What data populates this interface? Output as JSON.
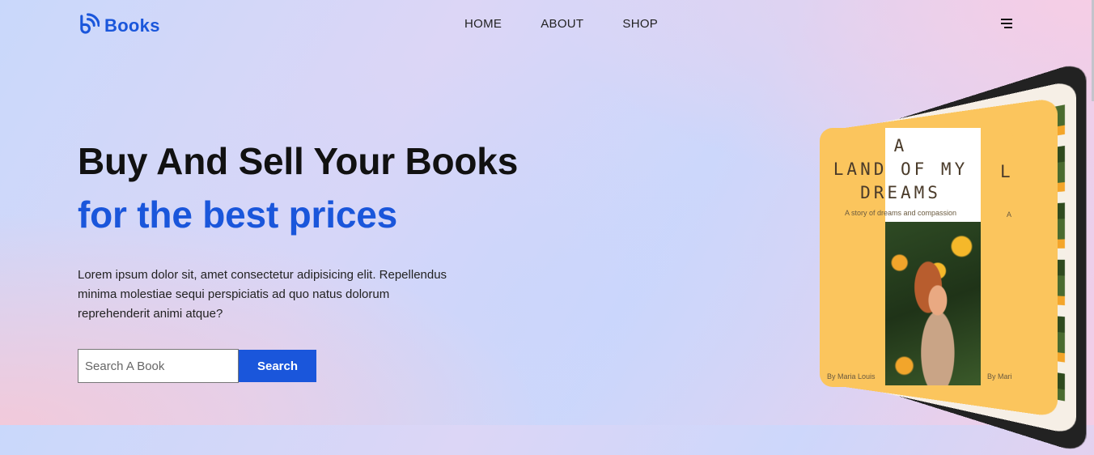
{
  "brand": {
    "name": "Books",
    "accent": "#1a56db",
    "icon": "rss-book-icon"
  },
  "nav": {
    "items": [
      "HOME",
      "ABOUT",
      "SHOP"
    ],
    "menu_icon": "hamburger-menu-icon"
  },
  "hero": {
    "title_line1": "Buy And Sell Your Books",
    "title_line2": "for the best prices",
    "description": "Lorem ipsum dolor sit, amet consectetur adipisicing elit. Repellendus minima molestiae sequi perspiciatis ad quo natus dolorum reprehenderit animi atque?"
  },
  "search": {
    "placeholder": "Search A Book",
    "value": "",
    "button_label": "Search"
  },
  "book": {
    "title": "A\nLAND OF MY\nDREAMS",
    "tagline": "A story of dreams and compassion",
    "author": "By Maria Louis",
    "next_title_fragment": "L",
    "next_tagline_fragment": "A",
    "next_author_fragment": "By Mari"
  }
}
